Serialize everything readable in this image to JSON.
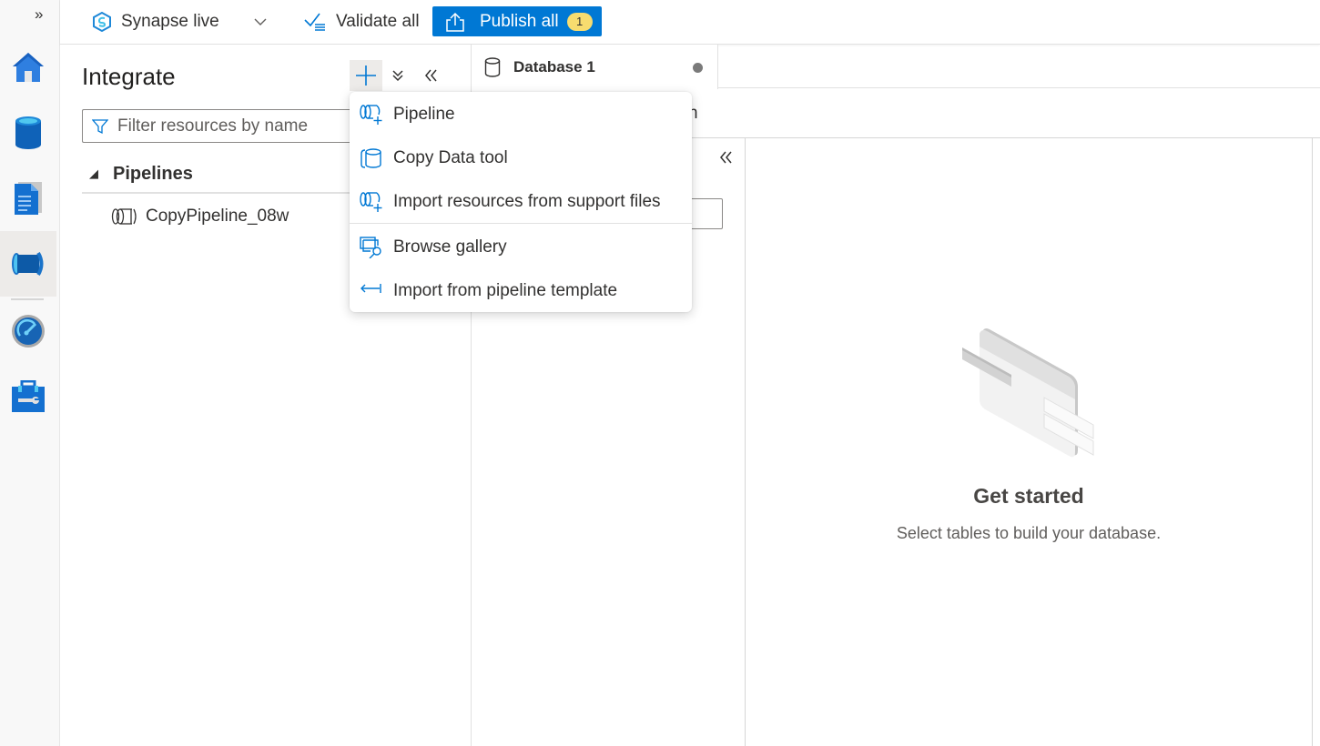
{
  "rail": {
    "expand_label": "»",
    "items": [
      {
        "name": "home",
        "icon": "home-icon"
      },
      {
        "name": "data",
        "icon": "database-icon"
      },
      {
        "name": "develop",
        "icon": "document-icon"
      },
      {
        "name": "integrate",
        "icon": "pipeline-icon",
        "active": true
      },
      {
        "name": "monitor",
        "icon": "gauge-icon"
      },
      {
        "name": "manage",
        "icon": "toolbox-icon"
      }
    ]
  },
  "toolbar": {
    "workspace_mode": "Synapse live",
    "validate_label": "Validate all",
    "publish_label": "Publish all",
    "publish_count": "1"
  },
  "integrate_pane": {
    "title": "Integrate",
    "filter_placeholder": "Filter resources by name",
    "section_label": "Pipelines",
    "items": [
      {
        "label": "CopyPipeline_08w"
      }
    ]
  },
  "add_menu": {
    "items": [
      {
        "label": "Pipeline",
        "icon": "pipeline-add-icon"
      },
      {
        "label": "Copy Data tool",
        "icon": "copy-data-icon"
      },
      {
        "label": "Import resources from support files",
        "icon": "import-resources-icon"
      },
      {
        "label": "Browse gallery",
        "icon": "gallery-icon"
      },
      {
        "label": "Import from pipeline template",
        "icon": "import-template-icon"
      }
    ]
  },
  "editor": {
    "tab_label": "Database 1",
    "tab_unsaved": true,
    "subbar_partial_text": "h",
    "empty_title": "Get started",
    "empty_message": "Select tables to build your database."
  },
  "colors": {
    "accent": "#0078d4",
    "badge": "#f7dc6f"
  }
}
